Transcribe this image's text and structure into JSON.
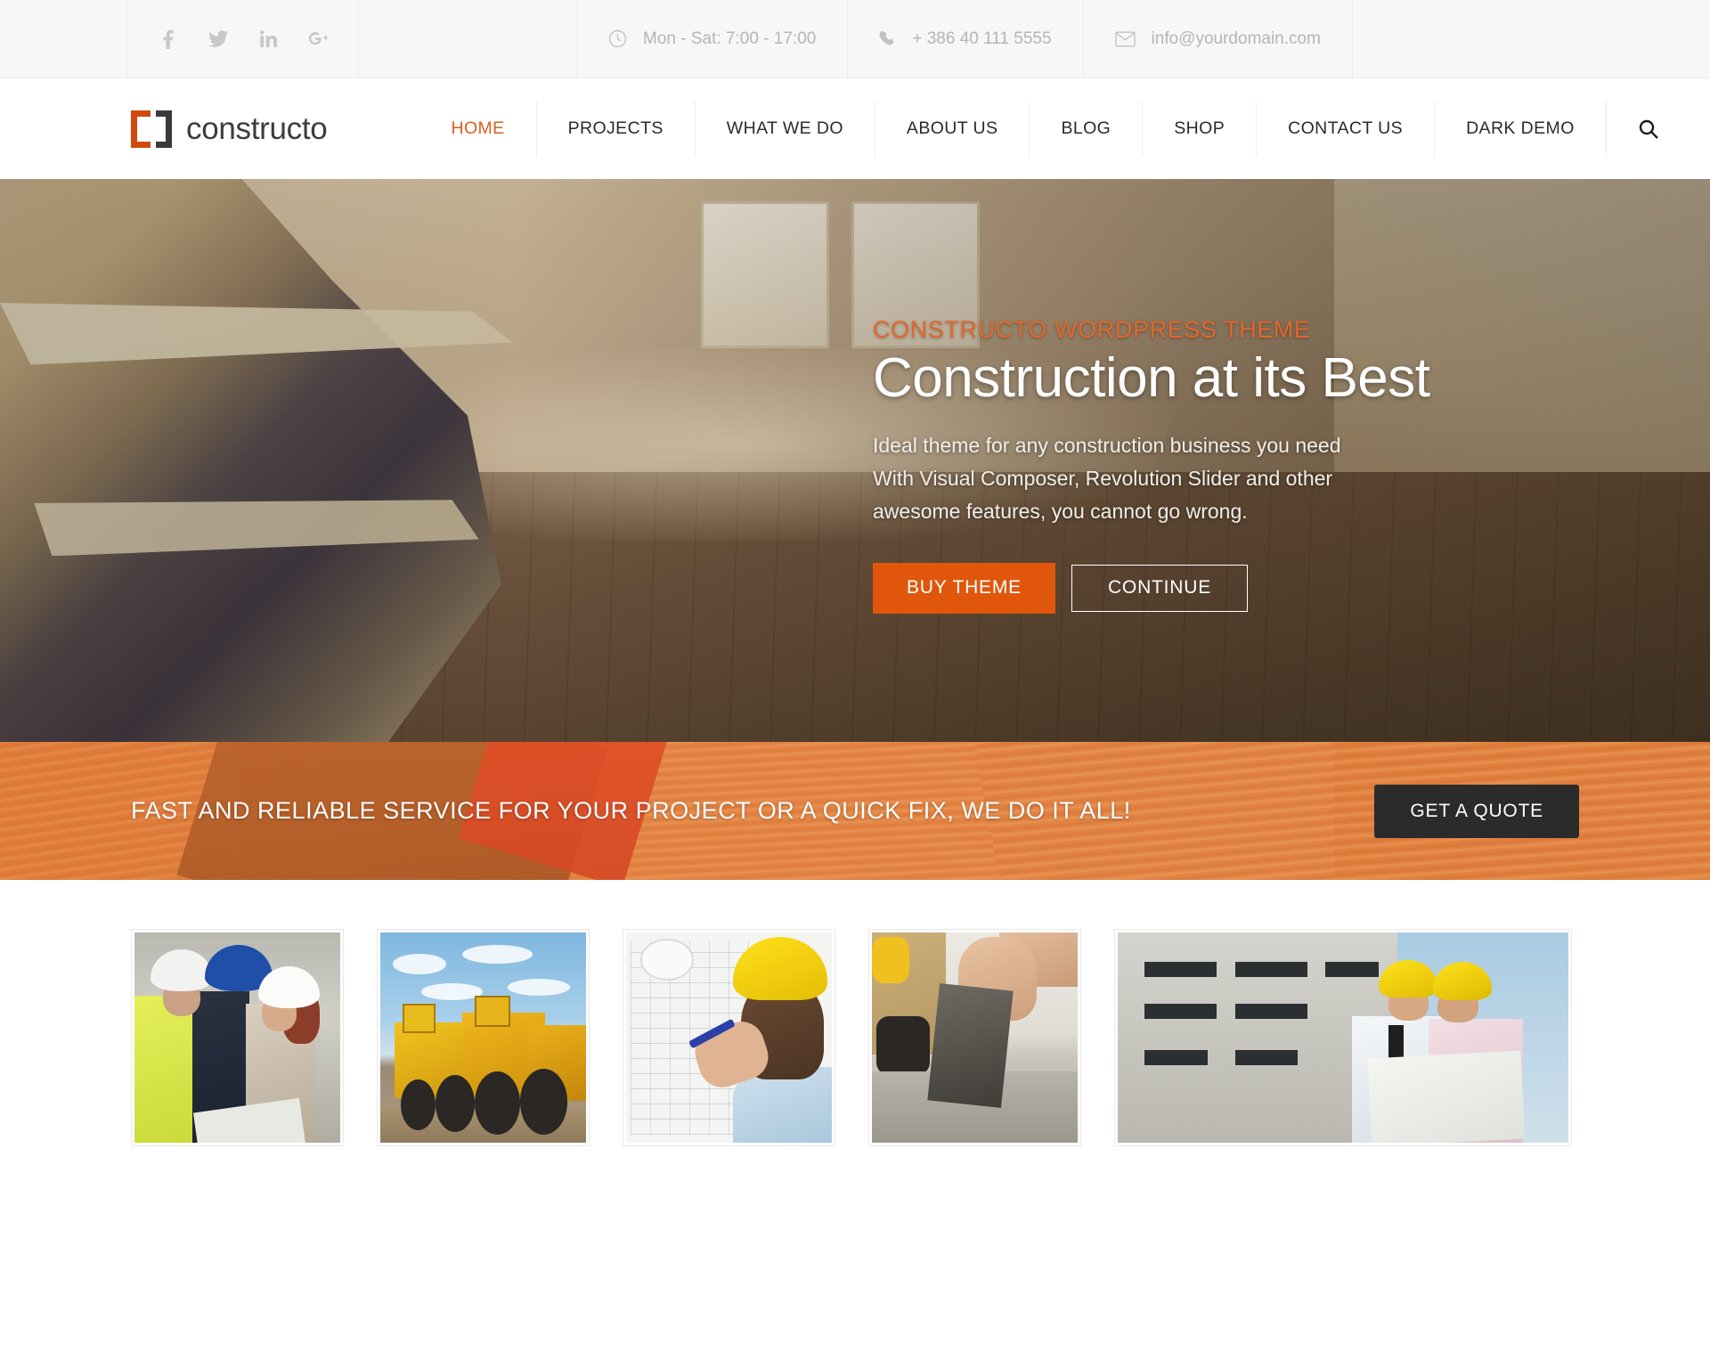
{
  "topbar": {
    "social": [
      {
        "name": "facebook-icon",
        "glyph": "f"
      },
      {
        "name": "twitter-icon",
        "glyph": "ᴠ"
      },
      {
        "name": "linkedin-icon",
        "glyph": "in"
      },
      {
        "name": "googleplus-icon",
        "glyph": "G+"
      }
    ],
    "hours": "Mon - Sat: 7:00 - 17:00",
    "phone": "+ 386 40 111 5555",
    "email": "info@yourdomain.com"
  },
  "header": {
    "logo_text": "constructo",
    "logo_accent_color": "#d0490f",
    "nav": [
      {
        "label": "HOME",
        "active": true
      },
      {
        "label": "PROJECTS",
        "active": false
      },
      {
        "label": "WHAT WE DO",
        "active": false
      },
      {
        "label": "ABOUT US",
        "active": false
      },
      {
        "label": "BLOG",
        "active": false
      },
      {
        "label": "SHOP",
        "active": false
      },
      {
        "label": "CONTACT US",
        "active": false
      },
      {
        "label": "DARK DEMO",
        "active": false
      }
    ],
    "search_icon": "search-icon",
    "active_color": "#d95f1e"
  },
  "hero": {
    "kicker": "CONSTRUCTO WORDPRESS THEME",
    "title": "Construction at its Best",
    "description": "Ideal theme for any construction business you need With Visual Composer, Revolution Slider and other awesome features, you cannot go wrong.",
    "primary_button": "BUY THEME",
    "secondary_button": "CONTINUE",
    "primary_color": "#e0570c",
    "kicker_color": "#e2672a"
  },
  "cta": {
    "text": "FAST AND RELIABLE SERVICE FOR YOUR PROJECT OR A QUICK FIX, WE DO IT ALL!",
    "button": "GET A QUOTE",
    "background_color": "#e0762f",
    "button_color": "#2b2b2b"
  },
  "gallery": {
    "items": [
      {
        "name": "gallery-item-team-meeting",
        "alt": "Three workers with helmets reviewing plans"
      },
      {
        "name": "gallery-item-heavy-machinery",
        "alt": "Row of yellow excavators at a site"
      },
      {
        "name": "gallery-item-blueprint-drafting",
        "alt": "Engineer in yellow helmet drawing blueprints"
      },
      {
        "name": "gallery-item-concrete-trowel",
        "alt": "Hand smoothing cement with a notched trowel"
      },
      {
        "name": "gallery-item-site-managers",
        "alt": "Two managers with blueprint in front of building"
      }
    ]
  }
}
